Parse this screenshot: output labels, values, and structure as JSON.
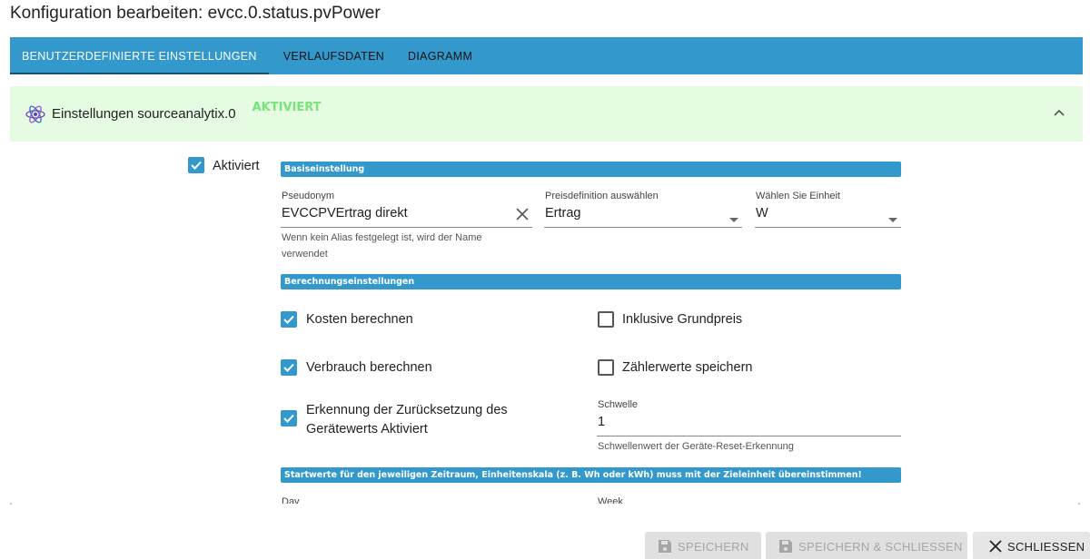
{
  "dialog": {
    "title": "Konfiguration bearbeiten: evcc.0.status.pvPower"
  },
  "tabs": [
    {
      "label": "BENUTZERDEFINIERTE EINSTELLUNGEN",
      "active": true
    },
    {
      "label": "VERLAUFSDATEN",
      "active": false
    },
    {
      "label": "DIAGRAMM",
      "active": false
    }
  ],
  "panel": {
    "label": "Einstellungen sourceanalytix.0",
    "status": "AKTIVIERT",
    "icon": "atom-icon",
    "collapse_icon": "chevron-up-icon"
  },
  "enabled": {
    "label": "Aktiviert",
    "checked": true
  },
  "sections": {
    "basic": "Basiseinstellung",
    "calc": "Berechnungseinstellungen",
    "start": "Startwerte für den jeweiligen Zeitraum, Einheitenskala (z. B. Wh oder kWh) muss mit der Zieleinheit übereinstimmen!"
  },
  "fields": {
    "alias": {
      "label": "Pseudonym",
      "value": "EVCCPVErtrag direkt",
      "helper_line1": "Wenn kein Alias festgelegt ist, wird der Name",
      "helper_line2": "verwendet"
    },
    "price": {
      "label": "Preisdefinition auswählen",
      "value": "Ertrag"
    },
    "unit": {
      "label": "Wählen Sie Einheit",
      "value": "W"
    },
    "threshold": {
      "label": "Schwelle",
      "value": "1",
      "helper": "Schwellenwert der Geräte-Reset-Erkennung"
    }
  },
  "options": {
    "costs": {
      "label": "Kosten berechnen",
      "checked": true
    },
    "basic_price": {
      "label": "Inklusive Grundpreis",
      "checked": false
    },
    "consumption": {
      "label": "Verbrauch berechnen",
      "checked": true
    },
    "meter": {
      "label": "Zählerwerte speichern",
      "checked": false
    },
    "reset_line1": "Erkennung der Zurücksetzung des",
    "reset_line2": "Gerätewerts Aktiviert",
    "reset_checked": true
  },
  "partial": {
    "day": "Day",
    "week": "Week"
  },
  "buttons": {
    "save": "SPEICHERN",
    "save_close": "SPEICHERN & SCHLIESSEN",
    "close": "SCHLIESSEN"
  },
  "colors": {
    "accent": "#3399cc",
    "panel_bg": "#e5fbe2",
    "status_green": "#7be37b"
  }
}
